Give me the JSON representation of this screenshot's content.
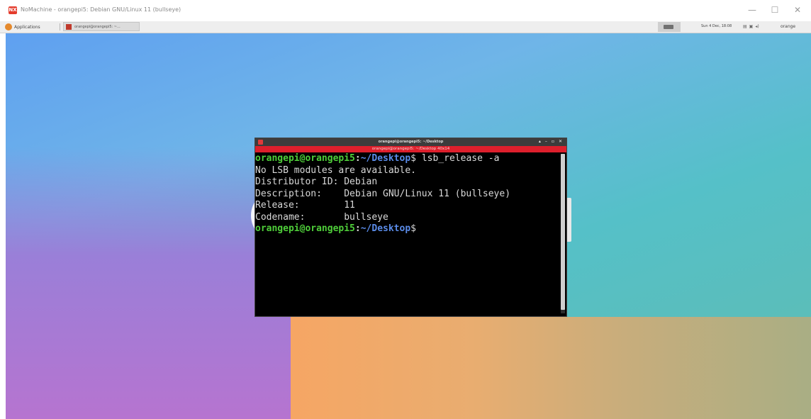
{
  "window": {
    "title": "NoMachine - orangepi5: Debian GNU/Linux 11 (bullseye)",
    "logo_text": "NX",
    "controls": [
      "—",
      "☐",
      "✕"
    ]
  },
  "panel": {
    "apps_label": "Applications",
    "task_label": "orangepi@orangepi5: ~...",
    "clock": "Sun 4 Dec, 18:08",
    "tray_icons": [
      "network-icon",
      "clipboard-icon",
      "volume-icon"
    ],
    "tray_glyphs": [
      "▤",
      "▣",
      "◂)"
    ],
    "user_label": "orange"
  },
  "terminal": {
    "title": "orangepi@orangepi5: ~/Desktop",
    "resize_text": "orangepi@orangepi5: ~/Desktop 40x14",
    "controls": [
      "▴",
      "–",
      "▫",
      "✕"
    ],
    "prompt_user": "orangepi@orangepi5",
    "prompt_colon": ":",
    "prompt_path": "~/Desktop",
    "prompt_symbol": "$",
    "command": " lsb_release -a",
    "output": [
      "No LSB modules are available.",
      "Distributor ID: Debian",
      "Description:    Debian GNU/Linux 11 (bullseye)",
      "Release:        11",
      "Codename:       bullseye"
    ]
  },
  "colors": {
    "prompt_user": "#4fcf3a",
    "prompt_path": "#5a8be8",
    "terminal_bg": "#000000",
    "resize_bar": "#dd1f2c"
  }
}
